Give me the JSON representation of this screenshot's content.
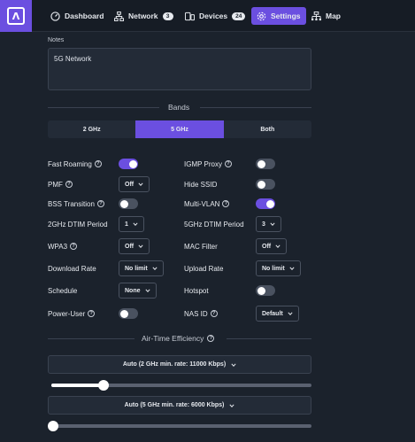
{
  "nav": {
    "items": [
      {
        "label": "Dashboard",
        "icon": "dashboard-icon"
      },
      {
        "label": "Network",
        "icon": "network-icon",
        "badge": "3"
      },
      {
        "label": "Devices",
        "icon": "devices-icon",
        "badge": "24"
      },
      {
        "label": "Settings",
        "icon": "gear-icon",
        "active": true
      },
      {
        "label": "Map",
        "icon": "map-icon"
      }
    ],
    "logo": "Λ"
  },
  "notes": {
    "label": "Notes",
    "value": "5G Network"
  },
  "bands": {
    "title": "Bands",
    "options": [
      "2 GHz",
      "5 GHz",
      "Both"
    ],
    "selected": "5 GHz"
  },
  "settings": {
    "left": [
      {
        "label": "Fast Roaming",
        "help": true,
        "type": "toggle",
        "on": true
      },
      {
        "label": "PMF",
        "help": true,
        "type": "select",
        "value": "Off"
      },
      {
        "label": "BSS Transition",
        "help": true,
        "type": "toggle",
        "on": false
      },
      {
        "label": "2GHz DTIM Period",
        "help": false,
        "type": "select",
        "value": "1"
      },
      {
        "label": "WPA3",
        "help": true,
        "type": "select",
        "value": "Off"
      },
      {
        "label": "Download Rate",
        "help": false,
        "type": "select",
        "value": "No limit"
      },
      {
        "label": "Schedule",
        "help": false,
        "type": "select",
        "value": "None"
      },
      {
        "label": "Power-User",
        "help": true,
        "type": "toggle",
        "on": false
      }
    ],
    "right": [
      {
        "label": "IGMP Proxy",
        "help": true,
        "type": "toggle",
        "on": false
      },
      {
        "label": "Hide SSID",
        "help": false,
        "type": "toggle",
        "on": false
      },
      {
        "label": "Multi-VLAN",
        "help": true,
        "type": "toggle",
        "on": true
      },
      {
        "label": "5GHz DTIM Period",
        "help": false,
        "type": "select",
        "value": "3"
      },
      {
        "label": "MAC Filter",
        "help": false,
        "type": "select",
        "value": "Off"
      },
      {
        "label": "Upload Rate",
        "help": false,
        "type": "select",
        "value": "No limit"
      },
      {
        "label": "Hotspot",
        "help": false,
        "type": "toggle",
        "on": false
      },
      {
        "label": "NAS ID",
        "help": true,
        "type": "select",
        "value": "Default"
      }
    ]
  },
  "airtime": {
    "title": "Air-Time Efficiency",
    "rate_2g": {
      "label": "Auto (2 GHz min. rate: 11000 Kbps)",
      "level": 0.2
    },
    "rate_5g": {
      "label": "Auto (5 GHz min. rate: 6000 Kbps)",
      "level": 0.0
    }
  },
  "colors": {
    "accent": "#6b4fe0",
    "background": "#1b222c"
  }
}
